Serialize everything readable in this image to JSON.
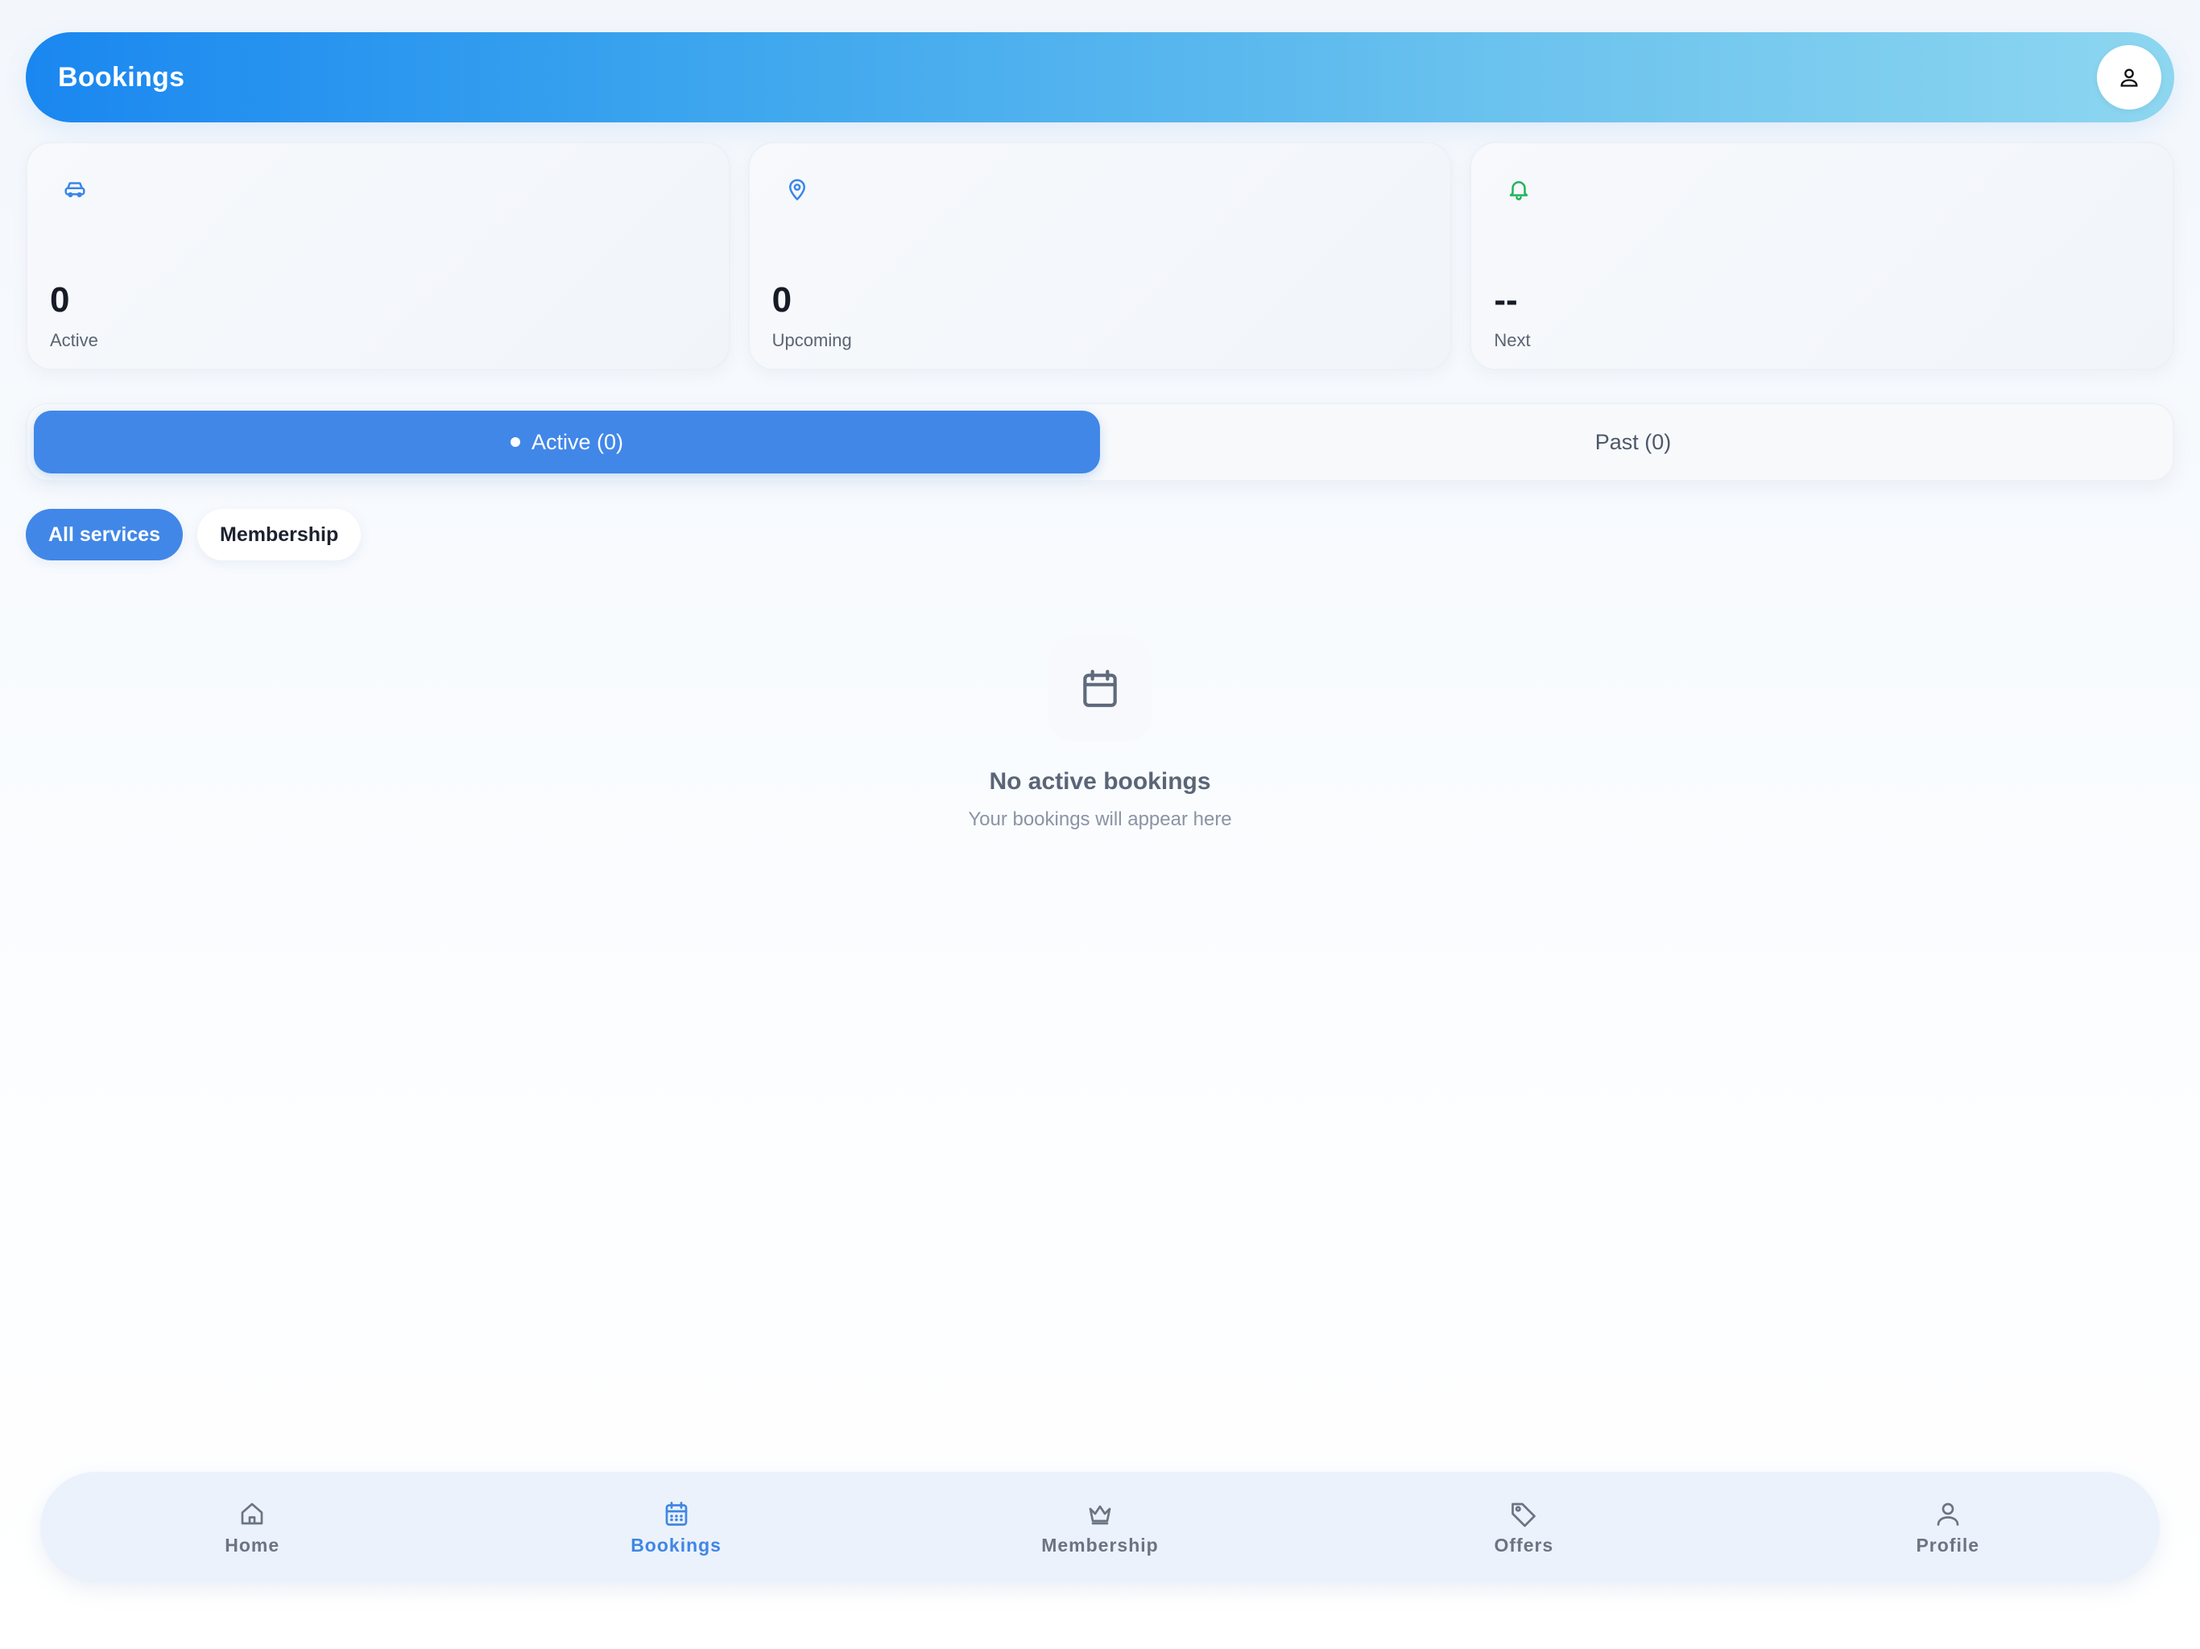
{
  "header": {
    "title": "Bookings",
    "profile_icon": "user-icon"
  },
  "stats": [
    {
      "icon": "car-icon",
      "value": "0",
      "label": "Active",
      "color": "#3a86e8"
    },
    {
      "icon": "map-pin-icon",
      "value": "0",
      "label": "Upcoming",
      "color": "#3a86e8"
    },
    {
      "icon": "bell-icon",
      "value": "--",
      "label": "Next",
      "color": "#22b35a"
    }
  ],
  "tabs": [
    {
      "label": "Active (0)",
      "active": true
    },
    {
      "label": "Past (0)",
      "active": false
    }
  ],
  "filters": [
    {
      "label": "All services",
      "selected": true
    },
    {
      "label": "Membership",
      "selected": false
    }
  ],
  "empty_state": {
    "icon": "calendar-icon",
    "title": "No active bookings",
    "subtitle": "Your bookings will appear here"
  },
  "nav": [
    {
      "label": "Home",
      "icon": "home-icon",
      "active": false
    },
    {
      "label": "Bookings",
      "icon": "calendar-icon",
      "active": true
    },
    {
      "label": "Membership",
      "icon": "crown-icon",
      "active": false
    },
    {
      "label": "Offers",
      "icon": "tag-icon",
      "active": false
    },
    {
      "label": "Profile",
      "icon": "user-icon",
      "active": false
    }
  ],
  "colors": {
    "accent": "#4187e8",
    "header_start": "#1a87f0",
    "header_end": "#8dd6f0"
  }
}
